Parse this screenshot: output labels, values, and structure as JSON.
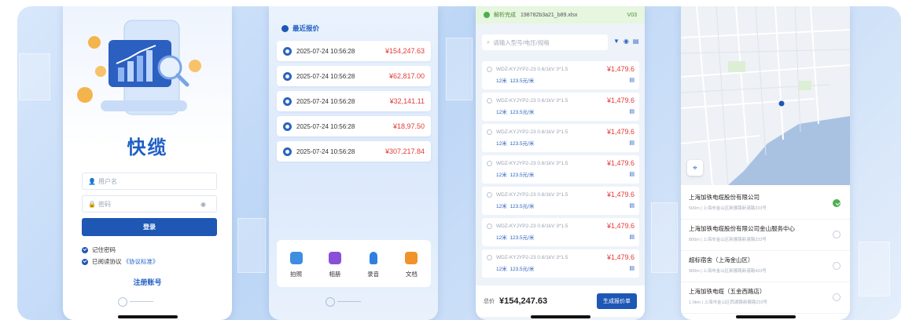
{
  "colors": {
    "primary": "#1e57b4",
    "price_red": "#e23a3a",
    "success_green": "#4caf50",
    "sea": "#a9c2e2"
  },
  "login": {
    "app_name": "快缆",
    "username_placeholder": "用户名",
    "password_placeholder": "密码",
    "login_button": "登录",
    "remember_password": "记住密码",
    "agree_prefix": "已阅读协议",
    "agreement_link": "《协议标准》",
    "register_link": "注册账号"
  },
  "quotes": {
    "title": "最近报价",
    "items": [
      {
        "date": "2025-07-24 10:56:28",
        "amount": "¥154,247.63"
      },
      {
        "date": "2025-07-24 10:56:28",
        "amount": "¥62,817.00"
      },
      {
        "date": "2025-07-24 10:56:28",
        "amount": "¥32,141.11"
      },
      {
        "date": "2025-07-24 10:56:28",
        "amount": "¥18,97.50"
      },
      {
        "date": "2025-07-24 10:56:28",
        "amount": "¥307,217.84"
      }
    ],
    "tools": [
      {
        "label": "拍照",
        "icon": "camera-icon",
        "color": "#3d8ee0"
      },
      {
        "label": "相册",
        "icon": "album-icon",
        "color": "#8a4fd8"
      },
      {
        "label": "录音",
        "icon": "microphone-icon",
        "color": "#2f7fe0"
      },
      {
        "label": "文档",
        "icon": "document-icon",
        "color": "#f0932b"
      }
    ]
  },
  "detail": {
    "banner_status": "解析完成",
    "banner_file": "198782b3a21_b89.xlsx",
    "banner_count": "V03",
    "search_placeholder": "请输入型号/电压/规格",
    "items": [
      {
        "code": "WDZ-KYJYP2-23  0.6/1kV  3*1.5",
        "qty": "12米",
        "unit_price": "123.5元/米",
        "price": "¥1,479.6"
      },
      {
        "code": "WDZ-KYJYP2-23  0.6/1kV  3*1.5",
        "qty": "12米",
        "unit_price": "123.5元/米",
        "price": "¥1,479.6"
      },
      {
        "code": "WDZ-KYJYP2-23  0.6/1kV  3*1.5",
        "qty": "12米",
        "unit_price": "123.5元/米",
        "price": "¥1,479.6"
      },
      {
        "code": "WDZ-KYJYP2-23  0.6/1kV  3*1.5",
        "qty": "12米",
        "unit_price": "123.5元/米",
        "price": "¥1,479.6"
      },
      {
        "code": "WDZ-KYJYP2-23  0.6/1kV  3*1.5",
        "qty": "12米",
        "unit_price": "123.5元/米",
        "price": "¥1,479.6"
      },
      {
        "code": "WDZ-KYJYP2-23  0.6/1kV  3*1.5",
        "qty": "12米",
        "unit_price": "123.5元/米",
        "price": "¥1,479.6"
      },
      {
        "code": "WDZ-KYJYP2-23  0.6/1kV  3*1.5",
        "qty": "12米",
        "unit_price": "123.5元/米",
        "price": "¥1,479.6"
      }
    ],
    "total_label": "总价",
    "total_value": "¥154,247.63",
    "generate_button": "生成报价单"
  },
  "places": [
    {
      "name": "上海加铁电缆股份有限公司",
      "addr": "500m | 上海市金山区新展路新港路233号",
      "selected": true
    },
    {
      "name": "上海加铁电缆股份有限公司金山服务中心",
      "addr": "800m | 上海市金山区新展路新港路233号",
      "selected": false
    },
    {
      "name": "超标宿舍（上海金山区）",
      "addr": "900m | 上海市金山区新展路新港路433号",
      "selected": false
    },
    {
      "name": "上海加铁电缆（五金西路店）",
      "addr": "1.0km | 上海市金山区西湖路新展路233号",
      "selected": false
    }
  ]
}
